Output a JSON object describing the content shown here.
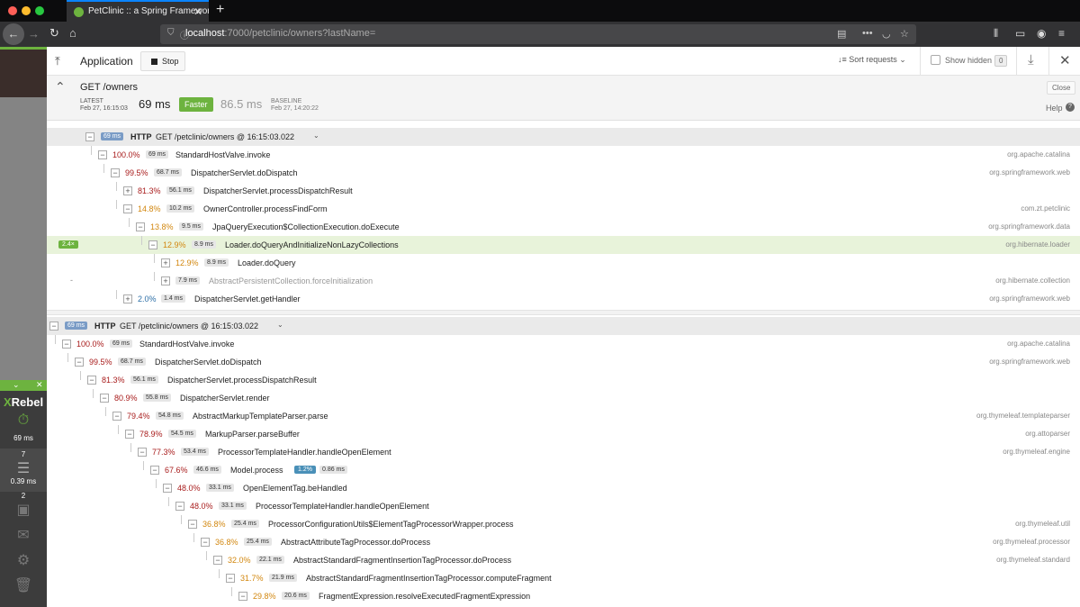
{
  "browser": {
    "tab_title": "PetClinic :: a Spring Framework",
    "url_host": "localhost",
    "url_rest": ":7000/petclinic/owners?lastName="
  },
  "sidebar": {
    "logo_x": "X",
    "logo_rest": "Rebel",
    "timer_value": "69 ms",
    "db_count": "7",
    "db_time": "0.39 ms",
    "io_count": "2"
  },
  "header": {
    "title": "Application",
    "stop_label": "Stop",
    "sort_label": "Sort requests",
    "show_hidden_label": "Show hidden",
    "hidden_count": "0"
  },
  "request": {
    "title": "GET /owners",
    "latest_label": "LATEST",
    "latest_date": "Feb 27, 16:15:03",
    "latest_ms": "69 ms",
    "faster_label": "Faster",
    "baseline_ms": "86.5 ms",
    "baseline_label": "BASELINE",
    "baseline_date": "Feb 27, 14:20:22",
    "close_label": "Close",
    "help_label": "Help"
  },
  "trace1": {
    "head": {
      "dur": "69 ms",
      "kind": "HTTP",
      "title": "GET /petclinic/owners @ 16:15:03.022"
    },
    "rows": [
      {
        "pct": "100.0%",
        "dur": "69 ms",
        "name": "StandardHostValve.invoke",
        "pkg": "org.apache.catalina"
      },
      {
        "pct": "99.5%",
        "dur": "68.7 ms",
        "name": "DispatcherServlet.doDispatch",
        "pkg": "org.springframework.web"
      },
      {
        "pct": "81.3%",
        "dur": "56.1 ms",
        "name": "DispatcherServlet.processDispatchResult",
        "pkg": ""
      },
      {
        "pct": "14.8%",
        "dur": "10.2 ms",
        "name": "OwnerController.processFindForm",
        "pkg": "com.zt.petclinic"
      },
      {
        "pct": "13.8%",
        "dur": "9.5 ms",
        "name": "JpaQueryExecution$CollectionExecution.doExecute",
        "pkg": "org.springframework.data"
      },
      {
        "pct": "12.9%",
        "dur": "8.9 ms",
        "name": "Loader.doQueryAndInitializeNonLazyCollections",
        "pkg": "org.hibernate.loader",
        "count": "2.4×"
      },
      {
        "pct": "12.9%",
        "dur": "8.9 ms",
        "name": "Loader.doQuery",
        "pkg": ""
      },
      {
        "pct": "",
        "dur": "7.9 ms",
        "name": "AbstractPersistentCollection.forceInitialization",
        "pkg": "org.hibernate.collection",
        "mark": "-"
      },
      {
        "pct": "2.0%",
        "dur": "1.4 ms",
        "name": "DispatcherServlet.getHandler",
        "pkg": "org.springframework.web"
      }
    ]
  },
  "trace2": {
    "head": {
      "dur": "69 ms",
      "kind": "HTTP",
      "title": "GET /petclinic/owners @ 16:15:03.022"
    },
    "rows": [
      {
        "pct": "100.0%",
        "dur": "69 ms",
        "name": "StandardHostValve.invoke",
        "pkg": "org.apache.catalina"
      },
      {
        "pct": "99.5%",
        "dur": "68.7 ms",
        "name": "DispatcherServlet.doDispatch",
        "pkg": "org.springframework.web"
      },
      {
        "pct": "81.3%",
        "dur": "56.1 ms",
        "name": "DispatcherServlet.processDispatchResult",
        "pkg": ""
      },
      {
        "pct": "80.9%",
        "dur": "55.8 ms",
        "name": "DispatcherServlet.render",
        "pkg": ""
      },
      {
        "pct": "79.4%",
        "dur": "54.8 ms",
        "name": "AbstractMarkupTemplateParser.parse",
        "pkg": "org.thymeleaf.templateparser"
      },
      {
        "pct": "78.9%",
        "dur": "54.5 ms",
        "name": "MarkupParser.parseBuffer",
        "pkg": "org.attoparser"
      },
      {
        "pct": "77.3%",
        "dur": "53.4 ms",
        "name": "ProcessorTemplateHandler.handleOpenElement",
        "pkg": "org.thymeleaf.engine"
      },
      {
        "pct": "67.6%",
        "dur": "46.6 ms",
        "name": "Model.process",
        "pkg": "",
        "db_pct": "1.2%",
        "db_dur": "0.86 ms"
      },
      {
        "pct": "48.0%",
        "dur": "33.1 ms",
        "name": "OpenElementTag.beHandled",
        "pkg": ""
      },
      {
        "pct": "48.0%",
        "dur": "33.1 ms",
        "name": "ProcessorTemplateHandler.handleOpenElement",
        "pkg": ""
      },
      {
        "pct": "36.8%",
        "dur": "25.4 ms",
        "name": "ProcessorConfigurationUtils$ElementTagProcessorWrapper.process",
        "pkg": "org.thymeleaf.util"
      },
      {
        "pct": "36.8%",
        "dur": "25.4 ms",
        "name": "AbstractAttributeTagProcessor.doProcess",
        "pkg": "org.thymeleaf.processor"
      },
      {
        "pct": "32.0%",
        "dur": "22.1 ms",
        "name": "AbstractStandardFragmentInsertionTagProcessor.doProcess",
        "pkg": "org.thymeleaf.standard"
      },
      {
        "pct": "31.7%",
        "dur": "21.9 ms",
        "name": "AbstractStandardFragmentInsertionTagProcessor.computeFragment",
        "pkg": ""
      },
      {
        "pct": "29.8%",
        "dur": "20.6 ms",
        "name": "FragmentExpression.resolveExecutedFragmentExpression",
        "pkg": ""
      }
    ]
  }
}
